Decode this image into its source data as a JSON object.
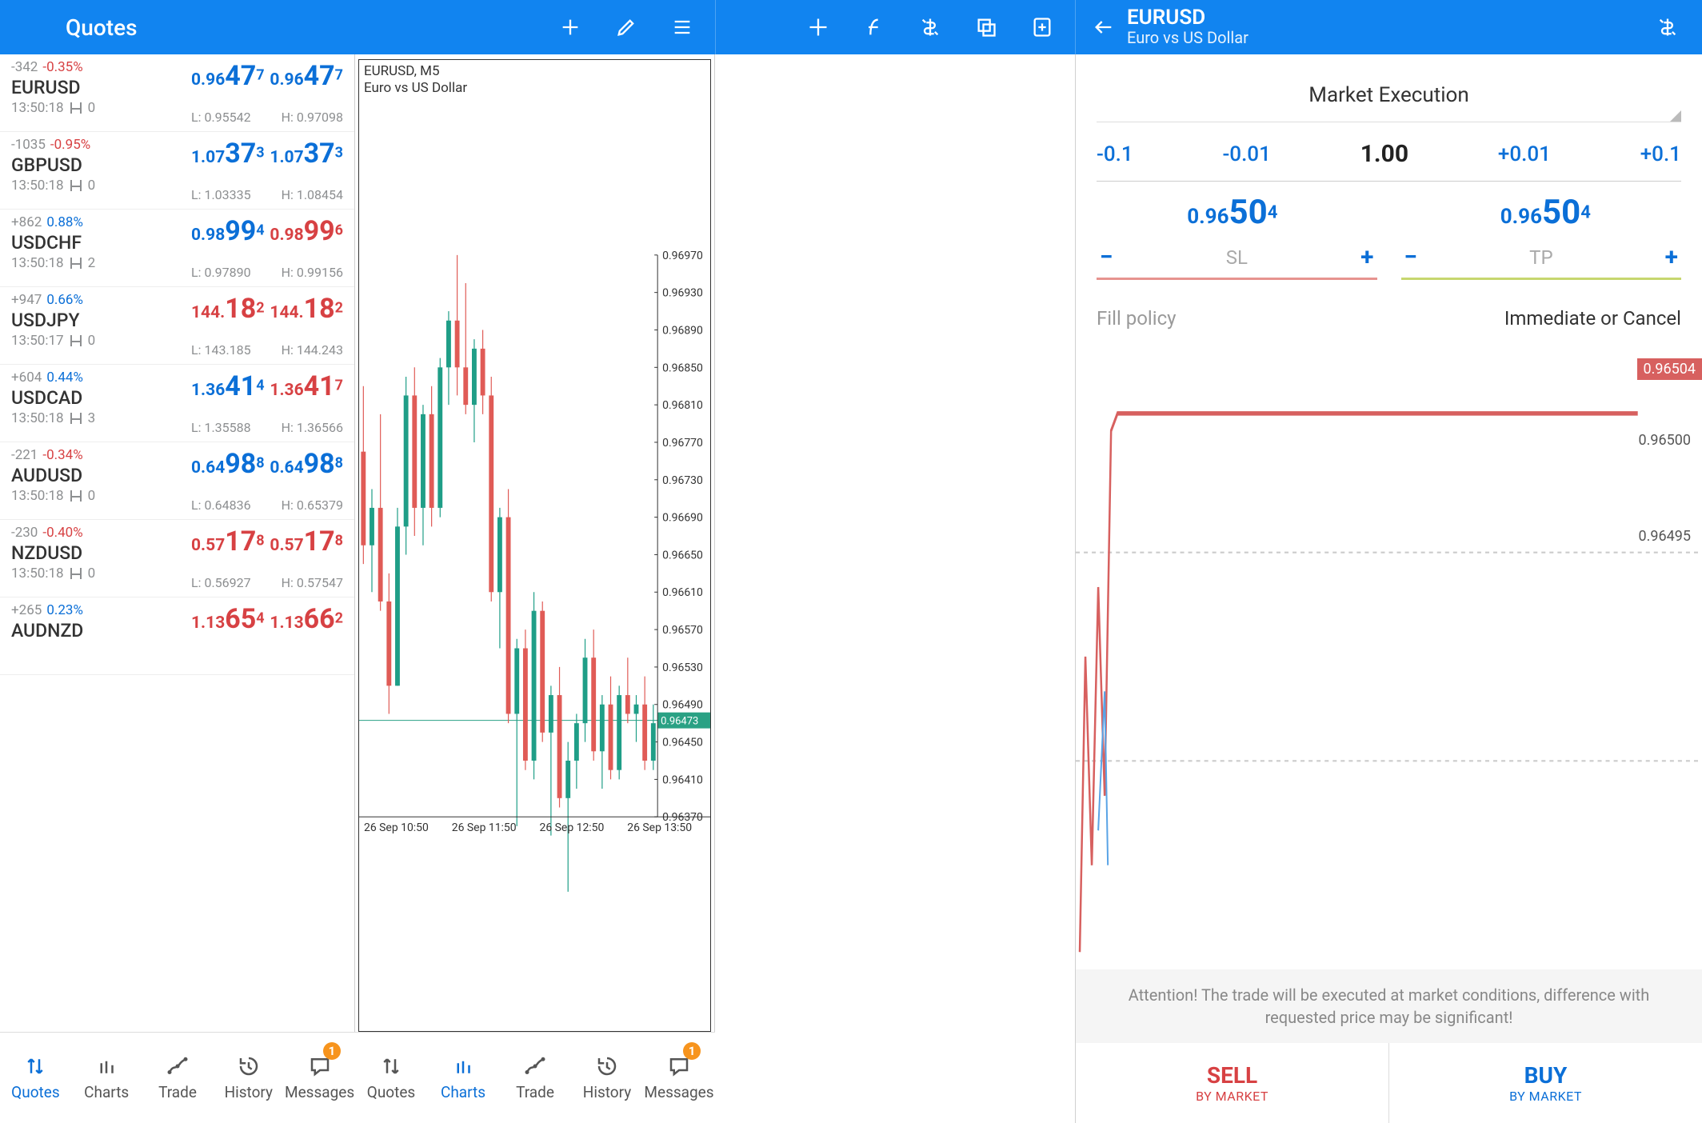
{
  "header": {
    "quotes_title": "Quotes",
    "symbol": "EURUSD",
    "symbol_desc": "Euro vs US Dollar"
  },
  "quotes": [
    {
      "sym": "EURUSD",
      "chg": "-342",
      "pct": "-0.35%",
      "pct_cls": "c-red",
      "time": "13:50:18",
      "spread": "0",
      "bid_lp": "0.96",
      "bid_bp": "47",
      "bid_sp": "7",
      "bid_cls": "c-blue",
      "ask_lp": "0.96",
      "ask_bp": "47",
      "ask_sp": "7",
      "ask_cls": "c-blue",
      "low": "L: 0.95542",
      "high": "H: 0.97098"
    },
    {
      "sym": "GBPUSD",
      "chg": "-1035",
      "pct": "-0.95%",
      "pct_cls": "c-red",
      "time": "13:50:18",
      "spread": "0",
      "bid_lp": "1.07",
      "bid_bp": "37",
      "bid_sp": "3",
      "bid_cls": "c-blue",
      "ask_lp": "1.07",
      "ask_bp": "37",
      "ask_sp": "3",
      "ask_cls": "c-blue",
      "low": "L: 1.03335",
      "high": "H: 1.08454"
    },
    {
      "sym": "USDCHF",
      "chg": "+862",
      "pct": "0.88%",
      "pct_cls": "c-blue",
      "time": "13:50:18",
      "spread": "2",
      "bid_lp": "0.98",
      "bid_bp": "99",
      "bid_sp": "4",
      "bid_cls": "c-blue",
      "ask_lp": "0.98",
      "ask_bp": "99",
      "ask_sp": "6",
      "ask_cls": "c-red",
      "low": "L: 0.97890",
      "high": "H: 0.99156"
    },
    {
      "sym": "USDJPY",
      "chg": "+947",
      "pct": "0.66%",
      "pct_cls": "c-blue",
      "time": "13:50:17",
      "spread": "0",
      "bid_lp": "144.",
      "bid_bp": "18",
      "bid_sp": "2",
      "bid_cls": "c-red",
      "ask_lp": "144.",
      "ask_bp": "18",
      "ask_sp": "2",
      "ask_cls": "c-red",
      "low": "L: 143.185",
      "high": "H: 144.243"
    },
    {
      "sym": "USDCAD",
      "chg": "+604",
      "pct": "0.44%",
      "pct_cls": "c-blue",
      "time": "13:50:18",
      "spread": "3",
      "bid_lp": "1.36",
      "bid_bp": "41",
      "bid_sp": "4",
      "bid_cls": "c-blue",
      "ask_lp": "1.36",
      "ask_bp": "41",
      "ask_sp": "7",
      "ask_cls": "c-red",
      "low": "L: 1.35588",
      "high": "H: 1.36566"
    },
    {
      "sym": "AUDUSD",
      "chg": "-221",
      "pct": "-0.34%",
      "pct_cls": "c-red",
      "time": "13:50:18",
      "spread": "0",
      "bid_lp": "0.64",
      "bid_bp": "98",
      "bid_sp": "8",
      "bid_cls": "c-blue",
      "ask_lp": "0.64",
      "ask_bp": "98",
      "ask_sp": "8",
      "ask_cls": "c-blue",
      "low": "L: 0.64836",
      "high": "H: 0.65379"
    },
    {
      "sym": "NZDUSD",
      "chg": "-230",
      "pct": "-0.40%",
      "pct_cls": "c-red",
      "time": "13:50:18",
      "spread": "0",
      "bid_lp": "0.57",
      "bid_bp": "17",
      "bid_sp": "8",
      "bid_cls": "c-red",
      "ask_lp": "0.57",
      "ask_bp": "17",
      "ask_sp": "8",
      "ask_cls": "c-red",
      "low": "L: 0.56927",
      "high": "H: 0.57547"
    },
    {
      "sym": "AUDNZD",
      "chg": "+265",
      "pct": "0.23%",
      "pct_cls": "c-blue",
      "time": "",
      "spread": "",
      "bid_lp": "1.13",
      "bid_bp": "65",
      "bid_sp": "4",
      "bid_cls": "c-red",
      "ask_lp": "1.13",
      "ask_bp": "66",
      "ask_sp": "2",
      "ask_cls": "c-red",
      "low": "",
      "high": ""
    }
  ],
  "chart": {
    "title_l1": "EURUSD, M5",
    "title_l2": "Euro vs US Dollar",
    "yticks": [
      "0.96970",
      "0.96930",
      "0.96890",
      "0.96850",
      "0.96810",
      "0.96770",
      "0.96730",
      "0.96690",
      "0.96650",
      "0.96610",
      "0.96570",
      "0.96530",
      "0.96490",
      "0.96450",
      "0.96410",
      "0.96370"
    ],
    "xticks": [
      "26 Sep 10:50",
      "26 Sep 11:50",
      "26 Sep 12:50",
      "26 Sep 13:50"
    ],
    "current_price": "0.96473"
  },
  "order": {
    "exec_type": "Market Execution",
    "steps_minus": [
      "-0.1",
      "-0.01"
    ],
    "volume": "1.00",
    "steps_plus": [
      "+0.01",
      "+0.1"
    ],
    "bid_lp": "0.96",
    "bid_bp": "50",
    "bid_sp": "4",
    "ask_lp": "0.96",
    "ask_bp": "50",
    "ask_sp": "4",
    "sl_label": "SL",
    "tp_label": "TP",
    "fill_label": "Fill policy",
    "fill_value": "Immediate or Cancel",
    "tick_badge": "0.96504",
    "tick_y": [
      "0.96500",
      "0.96495"
    ],
    "attention": "Attention! The trade will be executed at market conditions, difference with requested price may be significant!",
    "sell": "SELL",
    "sell_sub": "BY MARKET",
    "buy": "BUY",
    "buy_sub": "BY MARKET"
  },
  "tabs": {
    "items": [
      "Quotes",
      "Charts",
      "Trade",
      "History",
      "Messages"
    ],
    "badge": "1"
  },
  "chart_data": {
    "type": "candlestick",
    "symbol": "EURUSD",
    "timeframe": "M5",
    "ylim": [
      0.9637,
      0.9697
    ],
    "current": 0.96473,
    "x_labels": [
      "26 Sep 10:50",
      "26 Sep 11:50",
      "26 Sep 12:50",
      "26 Sep 13:50"
    ],
    "candles": [
      {
        "o": 0.9676,
        "h": 0.9683,
        "l": 0.9664,
        "c": 0.9666,
        "dir": "down"
      },
      {
        "o": 0.9666,
        "h": 0.9672,
        "l": 0.9661,
        "c": 0.967,
        "dir": "up"
      },
      {
        "o": 0.967,
        "h": 0.968,
        "l": 0.9659,
        "c": 0.966,
        "dir": "down"
      },
      {
        "o": 0.966,
        "h": 0.9663,
        "l": 0.9648,
        "c": 0.9651,
        "dir": "down"
      },
      {
        "o": 0.9651,
        "h": 0.967,
        "l": 0.9651,
        "c": 0.9668,
        "dir": "up"
      },
      {
        "o": 0.9668,
        "h": 0.9684,
        "l": 0.9665,
        "c": 0.9682,
        "dir": "up"
      },
      {
        "o": 0.9682,
        "h": 0.9685,
        "l": 0.9667,
        "c": 0.967,
        "dir": "down"
      },
      {
        "o": 0.967,
        "h": 0.9681,
        "l": 0.9666,
        "c": 0.968,
        "dir": "up"
      },
      {
        "o": 0.968,
        "h": 0.9683,
        "l": 0.9668,
        "c": 0.967,
        "dir": "down"
      },
      {
        "o": 0.967,
        "h": 0.9686,
        "l": 0.9669,
        "c": 0.9685,
        "dir": "up"
      },
      {
        "o": 0.9685,
        "h": 0.9691,
        "l": 0.9681,
        "c": 0.969,
        "dir": "up"
      },
      {
        "o": 0.969,
        "h": 0.9697,
        "l": 0.9682,
        "c": 0.9685,
        "dir": "down"
      },
      {
        "o": 0.9685,
        "h": 0.9694,
        "l": 0.968,
        "c": 0.9681,
        "dir": "down"
      },
      {
        "o": 0.9681,
        "h": 0.9688,
        "l": 0.9677,
        "c": 0.9687,
        "dir": "up"
      },
      {
        "o": 0.9687,
        "h": 0.9689,
        "l": 0.968,
        "c": 0.9682,
        "dir": "down"
      },
      {
        "o": 0.9682,
        "h": 0.9684,
        "l": 0.966,
        "c": 0.9661,
        "dir": "down"
      },
      {
        "o": 0.9661,
        "h": 0.967,
        "l": 0.9655,
        "c": 0.9669,
        "dir": "up"
      },
      {
        "o": 0.9669,
        "h": 0.9672,
        "l": 0.9647,
        "c": 0.9648,
        "dir": "down"
      },
      {
        "o": 0.9648,
        "h": 0.9656,
        "l": 0.9636,
        "c": 0.9655,
        "dir": "up"
      },
      {
        "o": 0.9655,
        "h": 0.9657,
        "l": 0.9642,
        "c": 0.9643,
        "dir": "down"
      },
      {
        "o": 0.9643,
        "h": 0.9661,
        "l": 0.9641,
        "c": 0.9659,
        "dir": "up"
      },
      {
        "o": 0.9659,
        "h": 0.966,
        "l": 0.9645,
        "c": 0.9646,
        "dir": "down"
      },
      {
        "o": 0.9646,
        "h": 0.9651,
        "l": 0.9635,
        "c": 0.965,
        "dir": "up"
      },
      {
        "o": 0.965,
        "h": 0.9653,
        "l": 0.9638,
        "c": 0.9639,
        "dir": "down"
      },
      {
        "o": 0.9639,
        "h": 0.9645,
        "l": 0.9629,
        "c": 0.9643,
        "dir": "up"
      },
      {
        "o": 0.9643,
        "h": 0.9648,
        "l": 0.964,
        "c": 0.9647,
        "dir": "up"
      },
      {
        "o": 0.9647,
        "h": 0.9656,
        "l": 0.9645,
        "c": 0.9654,
        "dir": "up"
      },
      {
        "o": 0.9654,
        "h": 0.9657,
        "l": 0.9643,
        "c": 0.9644,
        "dir": "down"
      },
      {
        "o": 0.9644,
        "h": 0.965,
        "l": 0.964,
        "c": 0.9649,
        "dir": "up"
      },
      {
        "o": 0.9649,
        "h": 0.9652,
        "l": 0.9641,
        "c": 0.9642,
        "dir": "down"
      },
      {
        "o": 0.9642,
        "h": 0.9651,
        "l": 0.9641,
        "c": 0.965,
        "dir": "up"
      },
      {
        "o": 0.965,
        "h": 0.9654,
        "l": 0.9647,
        "c": 0.9648,
        "dir": "down"
      },
      {
        "o": 0.9648,
        "h": 0.965,
        "l": 0.9645,
        "c": 0.9649,
        "dir": "up"
      },
      {
        "o": 0.9649,
        "h": 0.9652,
        "l": 0.9642,
        "c": 0.9643,
        "dir": "down"
      },
      {
        "o": 0.9643,
        "h": 0.9649,
        "l": 0.9642,
        "c": 0.9647,
        "dir": "up"
      }
    ]
  }
}
